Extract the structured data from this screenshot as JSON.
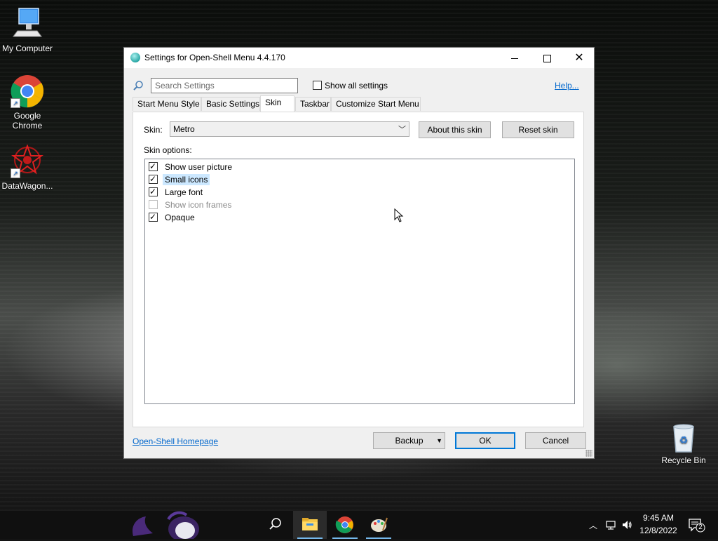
{
  "desktop": {
    "icons": [
      {
        "label": "My Computer"
      },
      {
        "label": "Google Chrome"
      },
      {
        "label": "DataWagon..."
      }
    ],
    "recycle_bin": {
      "label": "Recycle Bin"
    }
  },
  "window": {
    "title": "Settings for Open-Shell Menu 4.4.170",
    "search": {
      "placeholder": "Search Settings",
      "value": ""
    },
    "show_all": {
      "label": "Show all settings",
      "checked": false
    },
    "help_link": "Help...",
    "tabs": [
      {
        "label": "Start Menu Style",
        "active": false
      },
      {
        "label": "Basic Settings",
        "active": false
      },
      {
        "label": "Skin",
        "active": true
      },
      {
        "label": "Taskbar",
        "active": false
      },
      {
        "label": "Customize Start Menu",
        "active": false
      }
    ],
    "skin": {
      "label": "Skin:",
      "selected": "Metro",
      "about_button": "About this skin",
      "reset_button": "Reset skin",
      "options_label": "Skin options:",
      "options": [
        {
          "label": "Show user picture",
          "checked": true,
          "enabled": true,
          "highlighted": false
        },
        {
          "label": "Small icons",
          "checked": true,
          "enabled": true,
          "highlighted": true
        },
        {
          "label": "Large font",
          "checked": true,
          "enabled": true,
          "highlighted": false
        },
        {
          "label": "Show icon frames",
          "checked": false,
          "enabled": false,
          "highlighted": false
        },
        {
          "label": "Opaque",
          "checked": true,
          "enabled": true,
          "highlighted": false
        }
      ]
    },
    "footer": {
      "homepage_link": "Open-Shell Homepage",
      "backup_button": "Backup",
      "ok_button": "OK",
      "cancel_button": "Cancel"
    }
  },
  "taskbar": {
    "clock_time": "9:45 AM",
    "clock_date": "12/8/2022",
    "notification_count": "2",
    "accent_color": "#76b9ed"
  }
}
